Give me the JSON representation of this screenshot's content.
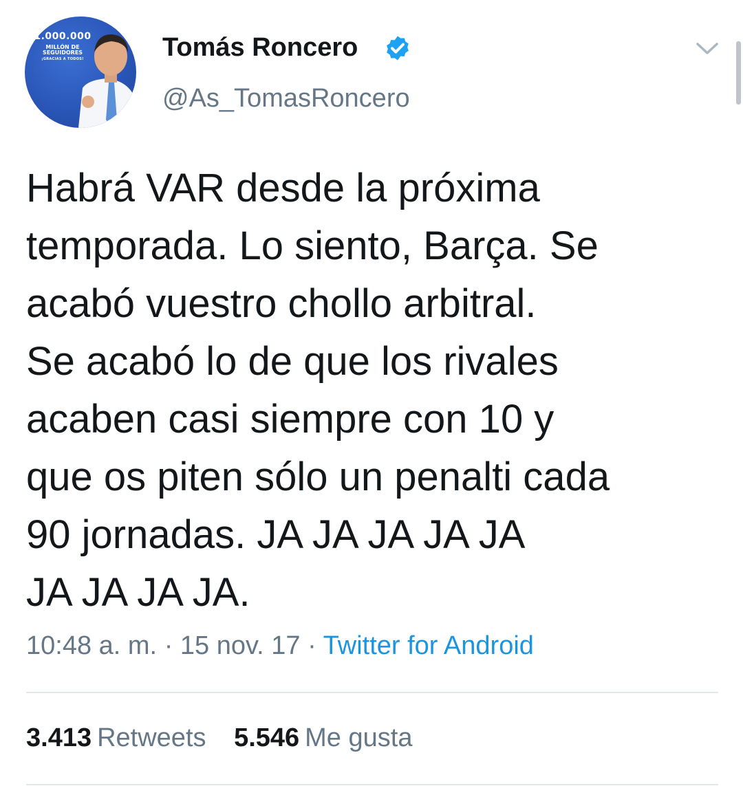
{
  "tweet": {
    "display_name": "Tomás Roncero",
    "handle": "@As_TomasRoncero",
    "verified": true,
    "avatar": {
      "line1": "1.000.000",
      "line2": "MILLÓN DE SEGUIDORES",
      "line3": "¡GRACIAS A TODOS!"
    },
    "text": "Habrá VAR desde la próxima\ntemporada. Lo siento, Barça. Se\nacabó vuestro chollo arbitral.\nSe acabó lo de que los rivales\nacaben casi siempre con 10 y\nque os piten sólo un penalti cada\n90 jornadas. JA JA JA JA JA\nJA JA JA JA.",
    "time": "10:48 a. m.",
    "date": "15 nov. 17",
    "separator": "·",
    "source": "Twitter for Android",
    "retweets_count": "3.413",
    "retweets_label": "Retweets",
    "likes_count": "5.546",
    "likes_label": "Me gusta"
  },
  "colors": {
    "verified": "#1da1f2",
    "link": "#1b95e0",
    "secondary_text": "#657786",
    "primary_text": "#14171a",
    "divider": "#e1e8ed"
  },
  "icons": {
    "verified": "verified-badge-icon",
    "caret": "chevron-down-icon"
  }
}
